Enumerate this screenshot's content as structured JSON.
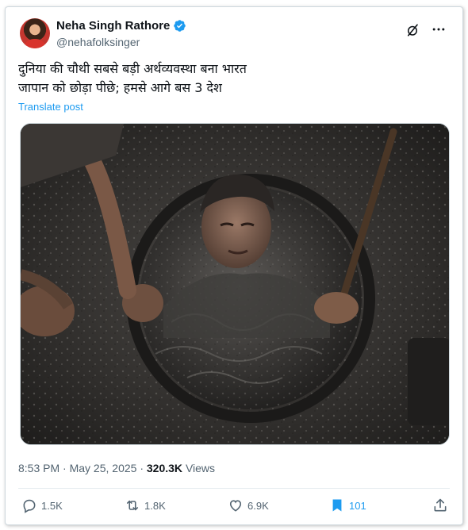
{
  "author": {
    "name": "Neha Singh Rathore",
    "handle": "@nehafolksinger",
    "verified": true
  },
  "post": {
    "line1": "दुनिया की चौथी सबसे बड़ी अर्थव्यवस्था बना भारत",
    "line2": "जापान को छोड़ा पीछे; हमसे आगे बस 3 देश",
    "translate_label": "Translate post"
  },
  "meta": {
    "time": "8:53 PM",
    "separator": "·",
    "date": "May 25, 2025",
    "views_count": "320.3K",
    "views_label": "Views"
  },
  "actions": {
    "replies": "1.5K",
    "reposts": "1.8K",
    "likes": "6.9K",
    "bookmarks": "101"
  },
  "colors": {
    "accent": "#1d9bf0",
    "secondary_text": "#536471",
    "verified_badge": "#1d9bf0"
  },
  "icons": [
    "verified-badge-icon",
    "grok-icon",
    "more-icon",
    "reply-icon",
    "repost-icon",
    "like-icon",
    "bookmark-icon",
    "share-icon"
  ]
}
